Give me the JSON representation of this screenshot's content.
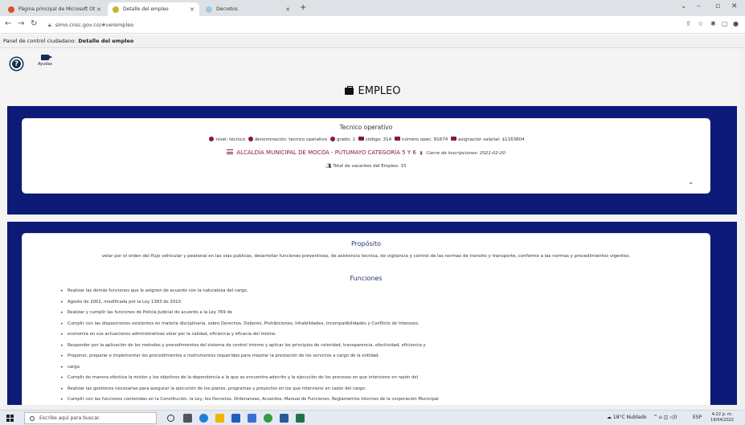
{
  "browser": {
    "tabs": [
      {
        "title": "Página principal de Microsoft Ot",
        "color": "#e44b23",
        "active": false
      },
      {
        "title": "Detalle del empleo",
        "color": "#c8b428",
        "active": true
      },
      {
        "title": "Decretos",
        "color": "#9ec9e8",
        "active": false
      }
    ],
    "url": "simo.cnsc.gov.co/#verempleo"
  },
  "app_header": {
    "prefix": "Panel de control ciudadano:",
    "title": "Detalle del empleo"
  },
  "toolbar": {
    "ayudas_label": "Ayudas",
    "help_glyph": "?"
  },
  "page": {
    "title": "EMPLEO"
  },
  "empleo": {
    "denominacion_title": "Tecnico operativo",
    "nivel": "nivel: técnico",
    "denominacion": "denominación: tecnico operativo",
    "grado": "grado: 1",
    "codigo": "código: 314",
    "numero_opec": "número opec: 81674",
    "asignacion": "asignación salarial: $1163804",
    "entidad": "ALCALDÍA MUNICIPAL DE MOCOA - PUTUMAYO CATEGORÍA 5 Y 6",
    "cierre": "Cierre de inscripciones: 2021-02-20",
    "vacantes": "Total de vacantes del Empleo: 15"
  },
  "proposito": {
    "heading": "Propósito",
    "text": "velar por el orden del flujo vehicular y peatonal en las vias publicas, desarrollar funciones preventivas, de asistencia tecnica, de vigilancia y control de las normas de transito y transporte, conforme a las normas y procedimientos vigentes."
  },
  "funciones": {
    "heading": "Funciones",
    "items": [
      "Realizar las demás funciones que le asignen de acuerdo con la naturaleza del cargo.",
      "Agosto de 2002, modificada por la Ley 1383 de 2010.",
      "Realizar y cumplir las funciones de Policía Judicial de acuerdo a la Ley 769 de",
      "Cumplir con las disposiciones existentes en materia disciplinaria, sobre Derechos, Deberes, Prohibiciones, Inhabilidades, Incompatibilidades y Conflicto de Intereses.",
      "economía en sus actuaciones administrativas velar por la calidad, eficiencia y eficacia del mismo.",
      "Responder por la aplicación de los metodos y procedimientos del sistema de control interno y aplicar los principios de celeridad, transparencia, efectividad, eficiencia y",
      "Proponer, preparar e implementar los procedimientos e instrumentos requeridos para mejorar la prestación de los servicios a cargo de la entidad.",
      "cargo.",
      "Cumplir de manera efectiva la misión y los objetivos de la dependencia a la que se encuentra adscrito y la ejecución de los procesos en que interviene en razón del",
      "Realizar las gestiones necesarias para asegurar la ejecución de los planes, programas y proyectos en los que interviene en razón del cargo.",
      "Cumplir con las funciones contenidas en la Constitución, la Ley, los Decretos, Ordenanzas, Acuerdos, Manual de Funciones, Reglamentos Internos de la corporación Municipal"
    ]
  },
  "taskbar": {
    "search_placeholder": "Escribe aquí para buscar.",
    "weather": "18°C Nublado",
    "lang": "ESP",
    "time": "4:22 p. m.",
    "date": "19/04/2022"
  },
  "colors": {
    "navy": "#0d1a78",
    "maroon": "#8a1a2e",
    "heading_blue": "#23327a"
  }
}
